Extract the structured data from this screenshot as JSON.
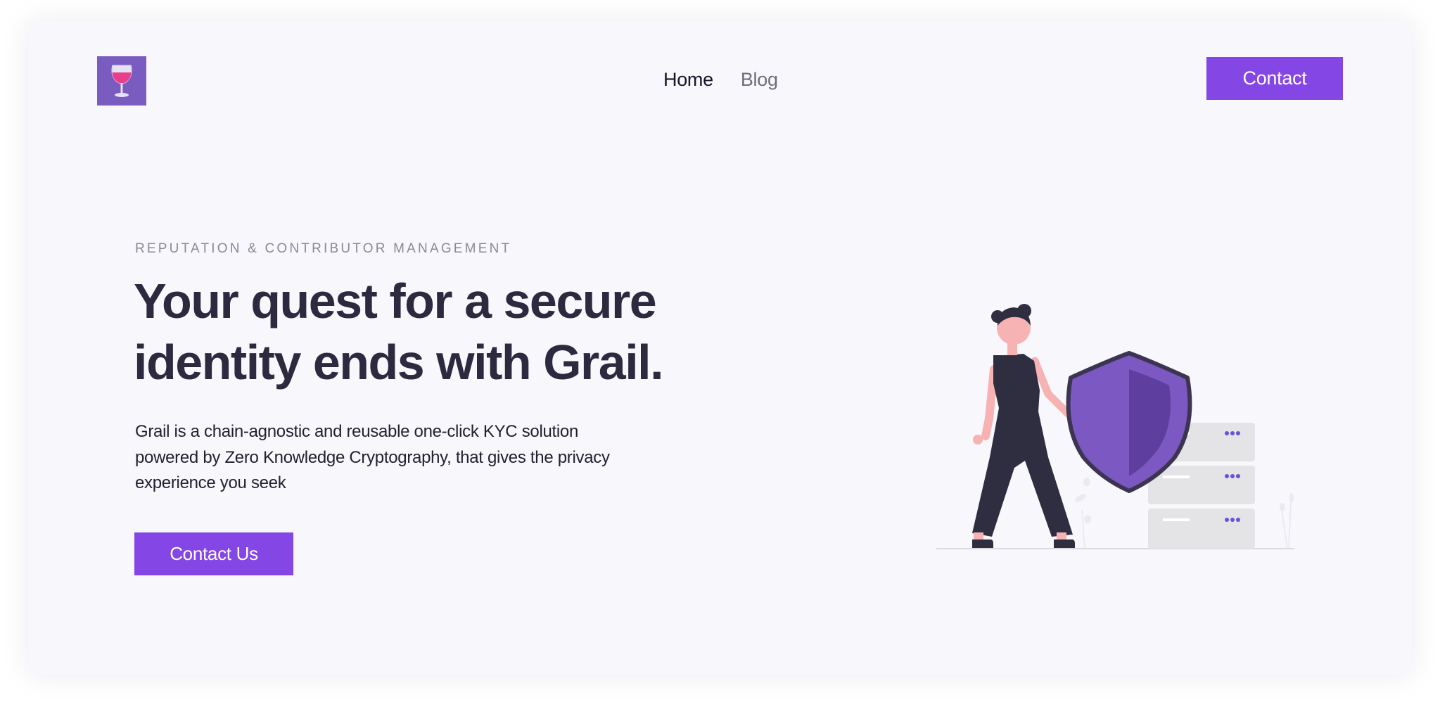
{
  "header": {
    "logo_icon": "wine-glass-icon",
    "nav": [
      {
        "label": "Home",
        "active": true
      },
      {
        "label": "Blog",
        "active": false
      }
    ],
    "contact_label": "Contact"
  },
  "hero": {
    "eyebrow": "REPUTATION & CONTRIBUTOR MANAGEMENT",
    "headline_lines": [
      "Your quest for a secure",
      "identity ends with Grail."
    ],
    "description_lines": [
      "Grail is a chain-agnostic and reusable one-click KYC solution",
      "powered by Zero Knowledge Cryptography, that gives the privacy",
      "experience you seek"
    ],
    "cta_label": "Contact Us"
  },
  "illustration": {
    "name": "woman-with-shield-and-servers-illustration"
  },
  "colors": {
    "accent": "#8546e6",
    "logo_bg": "#7a5bbf",
    "heading": "#2d2a40",
    "background": "#f8f7fc"
  }
}
